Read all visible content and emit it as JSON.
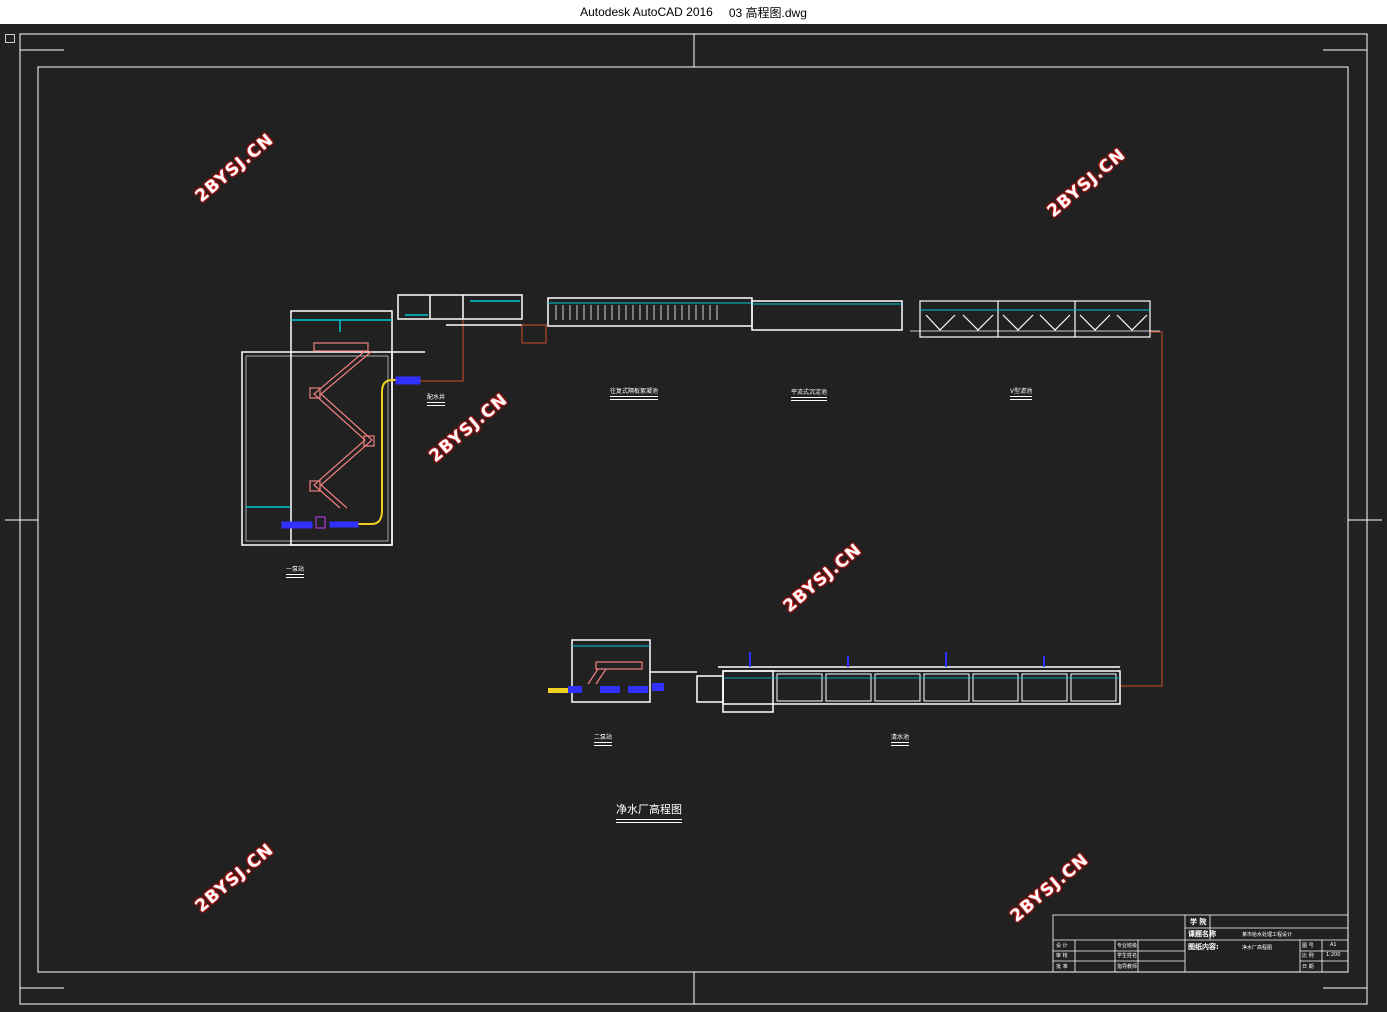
{
  "window": {
    "app_title": "Autodesk AutoCAD 2016",
    "file_name": "03 高程图.dwg"
  },
  "drawing": {
    "title": "净水厂高程图",
    "watermark": "2BYSJ.CN",
    "labels": {
      "pump1": "一泵站",
      "valve_well": "配水井",
      "sed_tank": "往复式隔板絮凝池",
      "hor_tank": "平流式沉淀池",
      "v_filter": "V型滤池",
      "pump2": "二泵站",
      "clear_tank": "清水池"
    },
    "colors": {
      "background": "#212121",
      "frame": "#ffffff",
      "pipe": "#d0502c",
      "water": "#00c8d8",
      "pump": "#3030ff",
      "stairs": "#f08080",
      "yellow_pipe": "#f0d020"
    }
  },
  "title_block": {
    "school": "学 院",
    "project_name_label": "课题名称",
    "project_name": "某市给水处理工程设计",
    "drawing_content_label": "图纸内容:",
    "drawing_content": "净水厂高程图",
    "designer": "设 计",
    "reviewer": "审 核",
    "approver": "批 准",
    "major_class": "专业班级",
    "student_name": "学生姓名",
    "advisor": "指导教师",
    "sheet_no_label": "图 号",
    "sheet_no": "A1",
    "scale_label": "比 例",
    "scale": "1:200",
    "date_label": "日 期"
  }
}
